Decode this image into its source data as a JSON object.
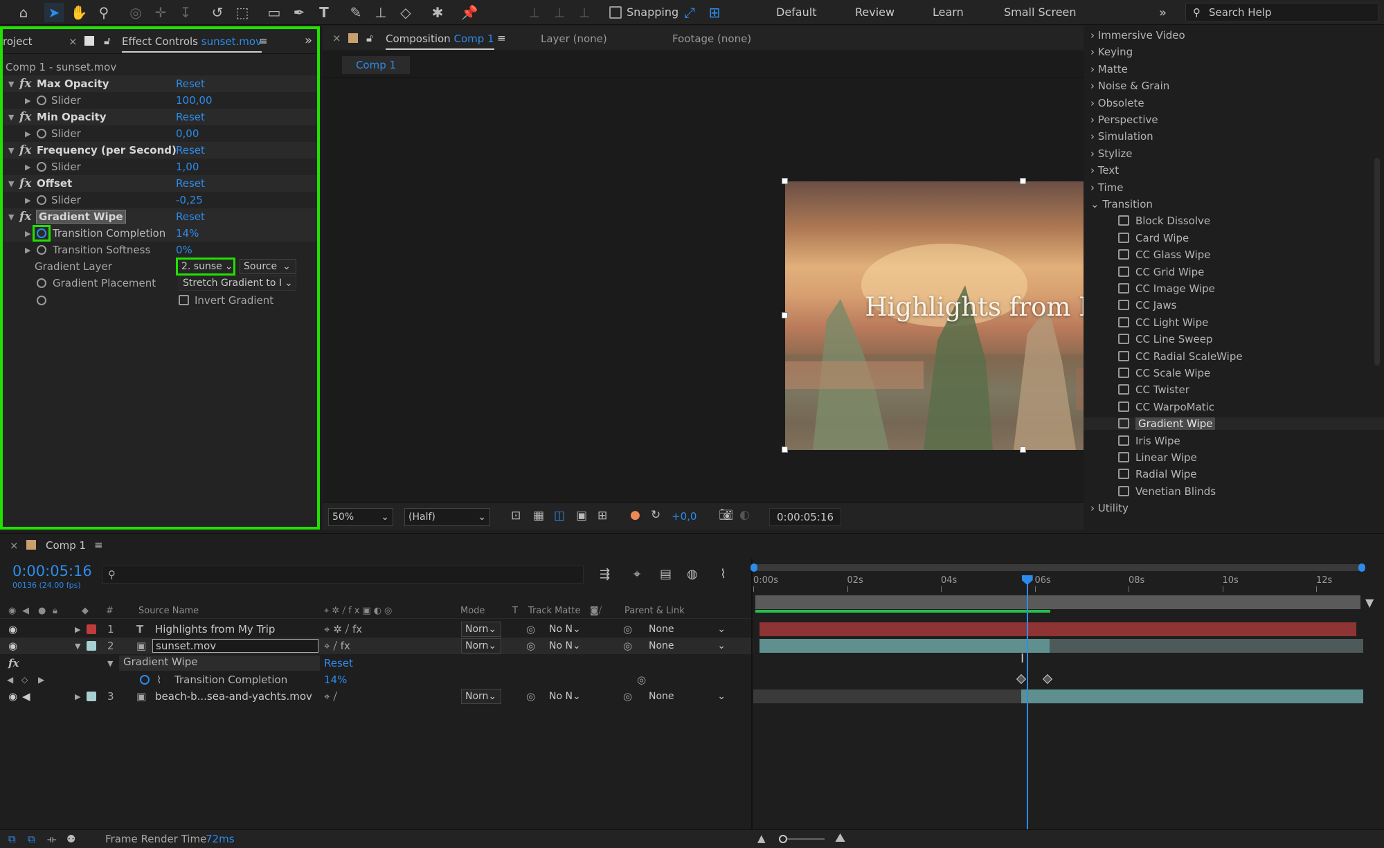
{
  "toolbar": {
    "snapping_label": "Snapping",
    "workspaces": [
      "Default",
      "Review",
      "Learn",
      "Small Screen"
    ],
    "search_placeholder": "Search Help"
  },
  "effect_controls": {
    "project_tab": "roject",
    "tab_label": "Effect Controls",
    "tab_layer": "sunset.mov",
    "header": "Comp 1 - sunset.mov",
    "effects": [
      {
        "name": "Max Opacity",
        "reset": "Reset",
        "prop": "Slider",
        "value": "100,00"
      },
      {
        "name": "Min Opacity",
        "reset": "Reset",
        "prop": "Slider",
        "value": "0,00"
      },
      {
        "name": "Frequency (per Second)",
        "reset": "Reset",
        "prop": "Slider",
        "value": "1,00"
      },
      {
        "name": "Offset",
        "reset": "Reset",
        "prop": "Slider",
        "value": "-0,25"
      }
    ],
    "gradient_wipe": {
      "name": "Gradient Wipe",
      "reset": "Reset",
      "transition_completion_label": "Transition Completion",
      "transition_completion_value": "14%",
      "transition_softness_label": "Transition Softness",
      "transition_softness_value": "0%",
      "gradient_layer_label": "Gradient Layer",
      "gradient_layer_value": "2. sunse",
      "gradient_layer_source": "Source",
      "gradient_placement_label": "Gradient Placement",
      "gradient_placement_value": "Stretch Gradient to I",
      "invert_label": "Invert Gradient"
    }
  },
  "composition": {
    "tab_label": "Composition",
    "tab_comp": "Comp 1",
    "layer_tab": "Layer (none)",
    "footage_tab": "Footage (none)",
    "comp_chip": "Comp 1",
    "overlay_title": "Highlights from My Trip",
    "zoom": "50%",
    "resolution": "(Half)",
    "exposure": "+0,0",
    "timecode": "0:00:05:16"
  },
  "library": {
    "categories_top": [
      "Immersive Video",
      "Keying",
      "Matte",
      "Noise & Grain",
      "Obsolete",
      "Perspective",
      "Simulation",
      "Stylize",
      "Text",
      "Time"
    ],
    "open_category": "Transition",
    "transitions": [
      "Block Dissolve",
      "Card Wipe",
      "CC Glass Wipe",
      "CC Grid Wipe",
      "CC Image Wipe",
      "CC Jaws",
      "CC Light Wipe",
      "CC Line Sweep",
      "CC Radial ScaleWipe",
      "CC Scale Wipe",
      "CC Twister",
      "CC WarpoMatic",
      "Gradient Wipe",
      "Iris Wipe",
      "Linear Wipe",
      "Radial Wipe",
      "Venetian Blinds"
    ],
    "selected": "Gradient Wipe",
    "categories_bottom": [
      "Utility"
    ]
  },
  "timeline": {
    "tab": "Comp 1",
    "timecode": "0:00:05:16",
    "frame_info": "00136 (24.00 fps)",
    "columns": {
      "num": "#",
      "source": "Source Name",
      "mode": "Mode",
      "t": "T",
      "track_matte": "Track Matte",
      "parent": "Parent & Link"
    },
    "ruler": [
      "0:00s",
      "02s",
      "04s",
      "06s",
      "08s",
      "10s",
      "12s"
    ],
    "current_time_fraction": 0.4485,
    "layers": [
      {
        "num": "1",
        "name": "Highlights from My Trip",
        "mode": "Norn",
        "matte": "No N",
        "parent": "None",
        "color": "#c23b3b"
      },
      {
        "num": "2",
        "name": "sunset.mov",
        "mode": "Norn",
        "matte": "No N",
        "parent": "None",
        "color": "#a7d0d0"
      },
      {
        "num": "3",
        "name": "beach-b...sea-and-yachts.mov",
        "mode": "Norn",
        "matte": "No N",
        "parent": "None",
        "color": "#a7d0d0"
      }
    ],
    "effect_row": {
      "name": "Gradient Wipe",
      "reset": "Reset"
    },
    "prop_row": {
      "name": "Transition Completion",
      "value": "14%"
    }
  },
  "status": {
    "label": "Frame Render Time",
    "value": "72ms"
  },
  "colors": {
    "accent": "#2d8ceb",
    "highlight": "#22e000",
    "layer1": "#8f3434",
    "layer2": "#5f8f8f"
  }
}
